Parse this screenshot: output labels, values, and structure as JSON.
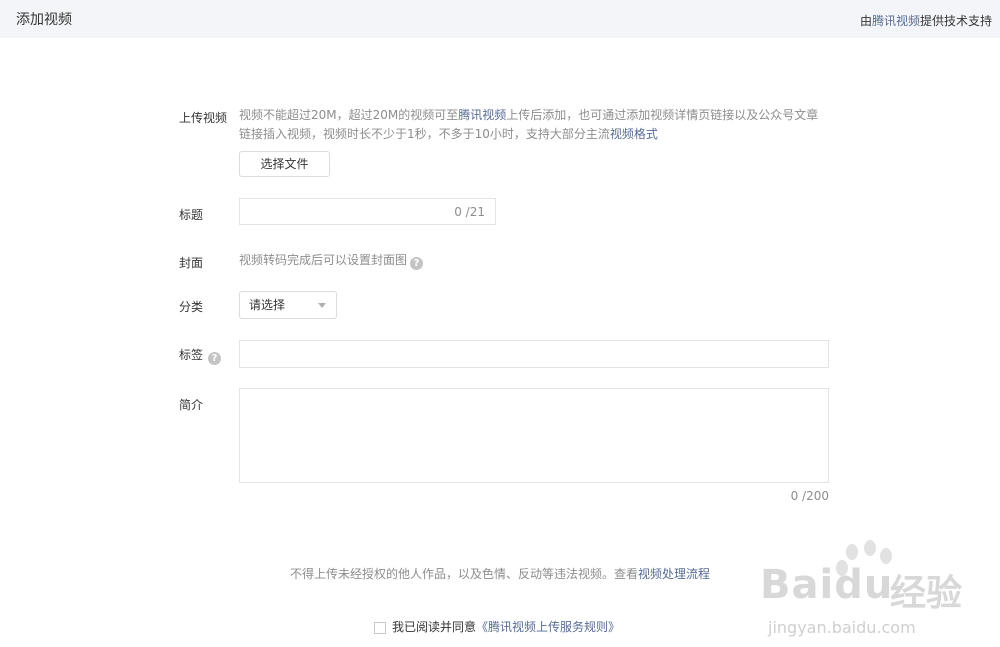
{
  "header": {
    "title": "添加视频",
    "powered_prefix": "由",
    "powered_link": "腾讯视频",
    "powered_suffix": "提供技术支持"
  },
  "upload": {
    "label": "上传视频",
    "desc_part1": "视频不能超过20M，超过20M的视频可至",
    "desc_link1": "腾讯视频",
    "desc_part2": "上传后添加，也可通过添加视频详情页链接以及公众号文章",
    "desc_line2": "链接插入视频，视频时长不少于1秒，不多于10小时，支持大部分主流",
    "desc_link2": "视频格式",
    "button": "选择文件"
  },
  "title_field": {
    "label": "标题",
    "value": "",
    "counter": "0 /21"
  },
  "cover": {
    "label": "封面",
    "desc": "视频转码完成后可以设置封面图",
    "help_icon": "?"
  },
  "category": {
    "label": "分类",
    "selected": "请选择"
  },
  "tags": {
    "label": "标签",
    "help_icon": "?",
    "value": ""
  },
  "intro": {
    "label": "简介",
    "value": "",
    "counter": "0 /200"
  },
  "notice": {
    "text": "不得上传未经授权的他人作品，以及色情、反动等违法视频。查看",
    "link": "视频处理流程"
  },
  "agreement": {
    "checked": false,
    "text": "我已阅读并同意",
    "link": "《腾讯视频上传服务规则》"
  },
  "watermark": {
    "brand": "Baidu",
    "brand_cn": "经验",
    "url": "jingyan.baidu.com"
  },
  "colors": {
    "link": "#576b95",
    "topbar_bg": "#f4f5f9",
    "text": "#353535",
    "muted": "#8d8d8d"
  }
}
